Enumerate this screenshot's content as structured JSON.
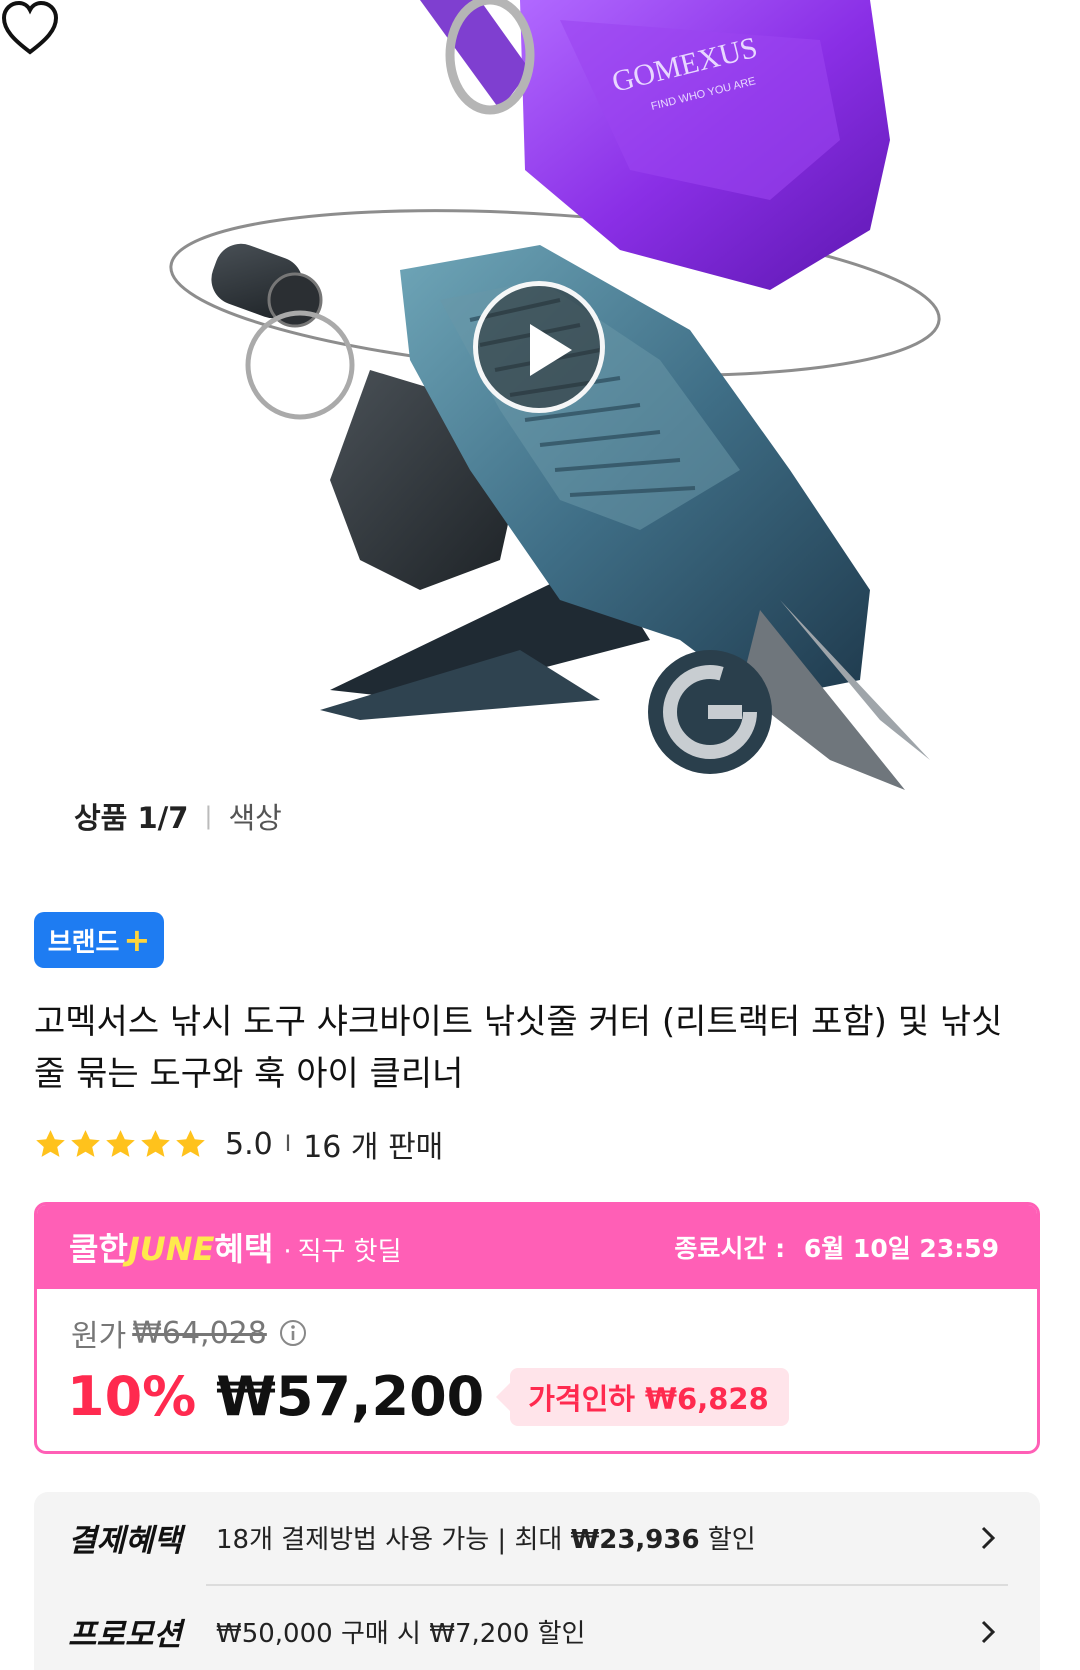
{
  "gallery": {
    "image_label": "상품 1/7",
    "option_label": "색상",
    "logo_text": "GOMEXUS",
    "logo_subtext": "FIND WHO YOU ARE"
  },
  "brand_badge": "브랜드",
  "product_title": "고멕서스 낚시 도구 샤크바이트 낚싯줄 커터 (리트랙터 포함) 및 낚싯줄 묶는 도구와 훅 아이 클리너",
  "rating": {
    "score": "5.0",
    "separator": "I",
    "sales": "16 개 판매",
    "stars": 5
  },
  "deal": {
    "brand_part1": "쿨한",
    "brand_part2": "JUNE",
    "brand_part3": "혜택",
    "dot": "·",
    "subtitle": "직구 핫딜",
    "end_label": "종료시간 :",
    "end_time": "6월 10일 23:59",
    "original_label": "원가",
    "original_price": "₩64,028",
    "discount_percent": "10%",
    "sale_price": "₩57,200",
    "price_drop": "가격인하 ₩6,828"
  },
  "benefits": {
    "payment_label": "결제혜택",
    "payment_count": "18",
    "payment_text": "개 결제방법 사용 가능 | 최대 ",
    "payment_amount": "₩23,936",
    "payment_suffix": " 할인",
    "promo_label": "프로모션",
    "promo_text": "₩50,000 구매 시 ₩7,200 할인"
  },
  "colors": {
    "deal_pink": "#ff5fb6",
    "discount_red": "#ff2a4f",
    "brand_blue": "#1e7cf2",
    "star_yellow": "#ffc21c"
  }
}
